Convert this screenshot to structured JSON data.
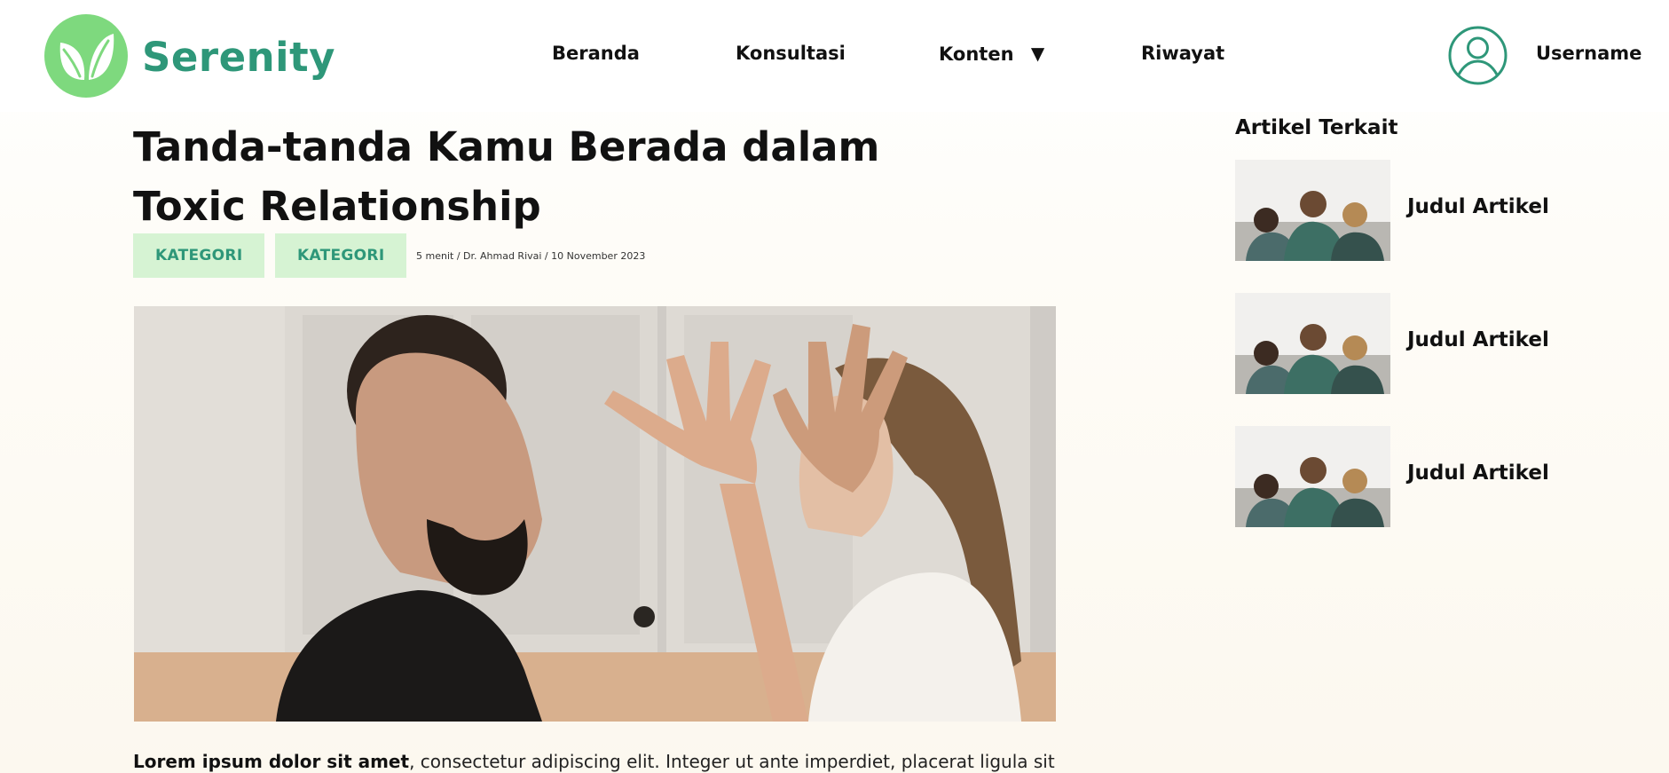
{
  "brand": {
    "name": "Serenity",
    "logo_icon": "leaf-icon",
    "color": "#2e9779",
    "logo_bg": "#7ed97e"
  },
  "nav": {
    "items": [
      {
        "label": "Beranda"
      },
      {
        "label": "Konsultasi"
      },
      {
        "label": "Konten",
        "icon": "caret-down-icon"
      },
      {
        "label": "Riwayat"
      }
    ]
  },
  "user": {
    "name": "Username",
    "icon": "user-circle-icon"
  },
  "article": {
    "title": "Tanda-tanda Kamu Berada dalam Toxic Relationship",
    "categories": [
      "KATEGORI",
      "KATEGORI"
    ],
    "meta": "5 menit / Dr. Ahmad Rivai / 10 November 2023",
    "image_alt": "couple-arguing-photo",
    "body_bold": "Lorem ipsum dolor sit amet",
    "body_rest": ", consectetur adipiscing elit. Integer ut ante imperdiet, placerat ligula sit"
  },
  "sidebar": {
    "heading": "Artikel Terkait",
    "items": [
      {
        "title": "Judul Artikel",
        "thumb": "family-photo"
      },
      {
        "title": "Judul Artikel",
        "thumb": "family-photo"
      },
      {
        "title": "Judul Artikel",
        "thumb": "family-photo"
      }
    ]
  },
  "colors": {
    "accent": "#2e9779",
    "badge_bg": "#d6f3d3",
    "background": "#fcf8ef"
  }
}
